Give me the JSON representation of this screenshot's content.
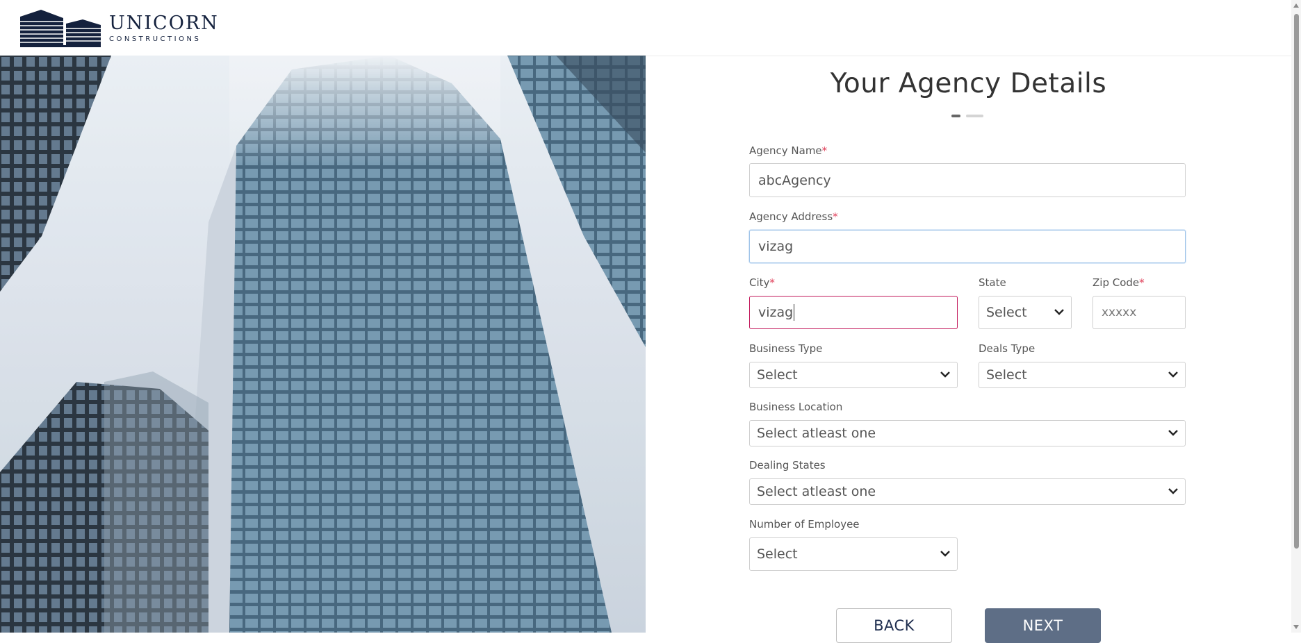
{
  "brand": {
    "name": "UNICORN",
    "tagline": "CONSTRUCTIONS",
    "color": "#14213d"
  },
  "form": {
    "title": "Your Agency Details",
    "required_marker": "*",
    "steps": {
      "current": 1,
      "total": 2
    },
    "agency_name": {
      "label": "Agency Name",
      "value": "abcAgency"
    },
    "agency_address": {
      "label": "Agency Address",
      "value": "vizag"
    },
    "city": {
      "label": "City",
      "value": "vizag"
    },
    "state": {
      "label": "State",
      "value": "Select"
    },
    "zip": {
      "label": "Zip Code",
      "placeholder": "xxxxx"
    },
    "business_type": {
      "label": "Business Type",
      "value": "Select"
    },
    "deals_type": {
      "label": "Deals Type",
      "value": "Select"
    },
    "business_location": {
      "label": "Business Location",
      "value": "Select atleast one"
    },
    "dealing_states": {
      "label": "Dealing States",
      "value": "Select atleast one"
    },
    "employees": {
      "label": "Number of Employee",
      "value": "Select"
    },
    "back_label": "BACK",
    "next_label": "NEXT"
  },
  "icons": {
    "logo": "building-logo-icon",
    "dropdown": "chevron-down-icon"
  },
  "colors": {
    "accent_next": "#5e6e86",
    "error_border": "#c2185b",
    "focus_border": "#9ec3e8",
    "required": "#e0405a"
  }
}
